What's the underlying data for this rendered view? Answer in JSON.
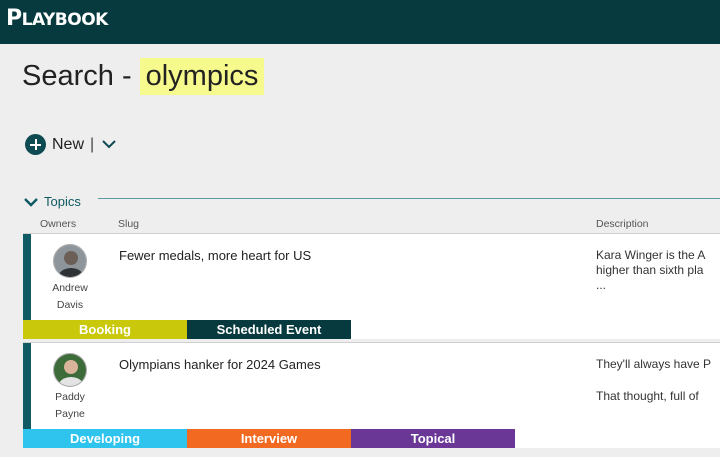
{
  "app": {
    "logo_big": "P",
    "logo_rest": "LAYBOOK"
  },
  "search": {
    "prefix": "Search -",
    "query": "olympics"
  },
  "toolbar": {
    "new_label": "New",
    "separator": "|"
  },
  "section": {
    "label": "Topics"
  },
  "columns": {
    "owners": "Owners",
    "slug": "Slug",
    "description": "Description"
  },
  "topics": [
    {
      "owner_first": "Andrew",
      "owner_last": "Davis",
      "slug": "Fewer medals, more heart for US",
      "desc_line1": "Kara Winger is the A",
      "desc_line2": "higher than sixth pla",
      "desc_line3": "...",
      "tags": [
        {
          "label": "Booking",
          "color": "#c9c80a"
        },
        {
          "label": "Scheduled Event",
          "color": "#073a3f"
        }
      ]
    },
    {
      "owner_first": "Paddy",
      "owner_last": "Payne",
      "slug": "Olympians hanker for 2024 Games",
      "desc_line1": "They'll always have P",
      "desc_line2": "That thought, full of",
      "tags": [
        {
          "label": "Developing",
          "color": "#2fc4ee"
        },
        {
          "label": "Interview",
          "color": "#f26a22"
        },
        {
          "label": "Topical",
          "color": "#6a3796"
        }
      ]
    }
  ]
}
